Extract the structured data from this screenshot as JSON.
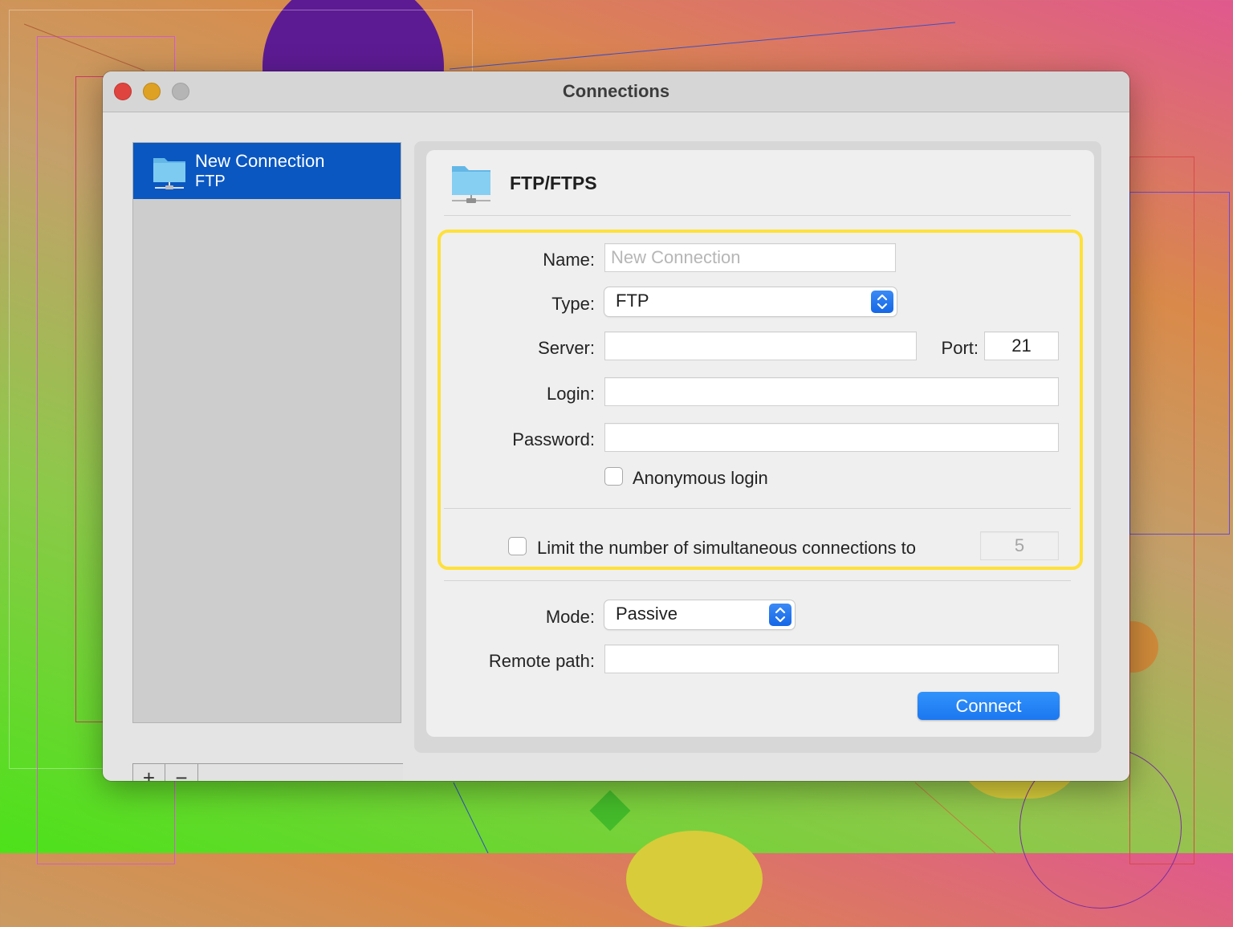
{
  "window": {
    "title": "Connections"
  },
  "sidebar": {
    "items": [
      {
        "title": "New Connection",
        "subtitle": "FTP",
        "icon": "network-folder-icon",
        "selected": true
      }
    ],
    "add_label": "+",
    "remove_label": "−"
  },
  "panel": {
    "title": "FTP/FTPS",
    "icon": "network-folder-icon",
    "form": {
      "name_label": "Name:",
      "name_placeholder": "New Connection",
      "name_value": "",
      "type_label": "Type:",
      "type_value": "FTP",
      "server_label": "Server:",
      "server_value": "",
      "port_label": "Port:",
      "port_value": "21",
      "login_label": "Login:",
      "login_value": "",
      "password_label": "Password:",
      "password_value": "",
      "anonymous_label": "Anonymous login",
      "anonymous_checked": false,
      "limit_label": "Limit the number of simultaneous connections to",
      "limit_checked": false,
      "limit_value": "5",
      "mode_label": "Mode:",
      "mode_value": "Passive",
      "remote_path_label": "Remote path:",
      "remote_path_value": "",
      "connect_label": "Connect"
    }
  },
  "colors": {
    "selection": "#0a57c2",
    "accent": "#1c77f0",
    "highlight": "#ffe03a",
    "close": "#e0443e",
    "minimize": "#dea123",
    "zoom": "#b5b5b5"
  }
}
